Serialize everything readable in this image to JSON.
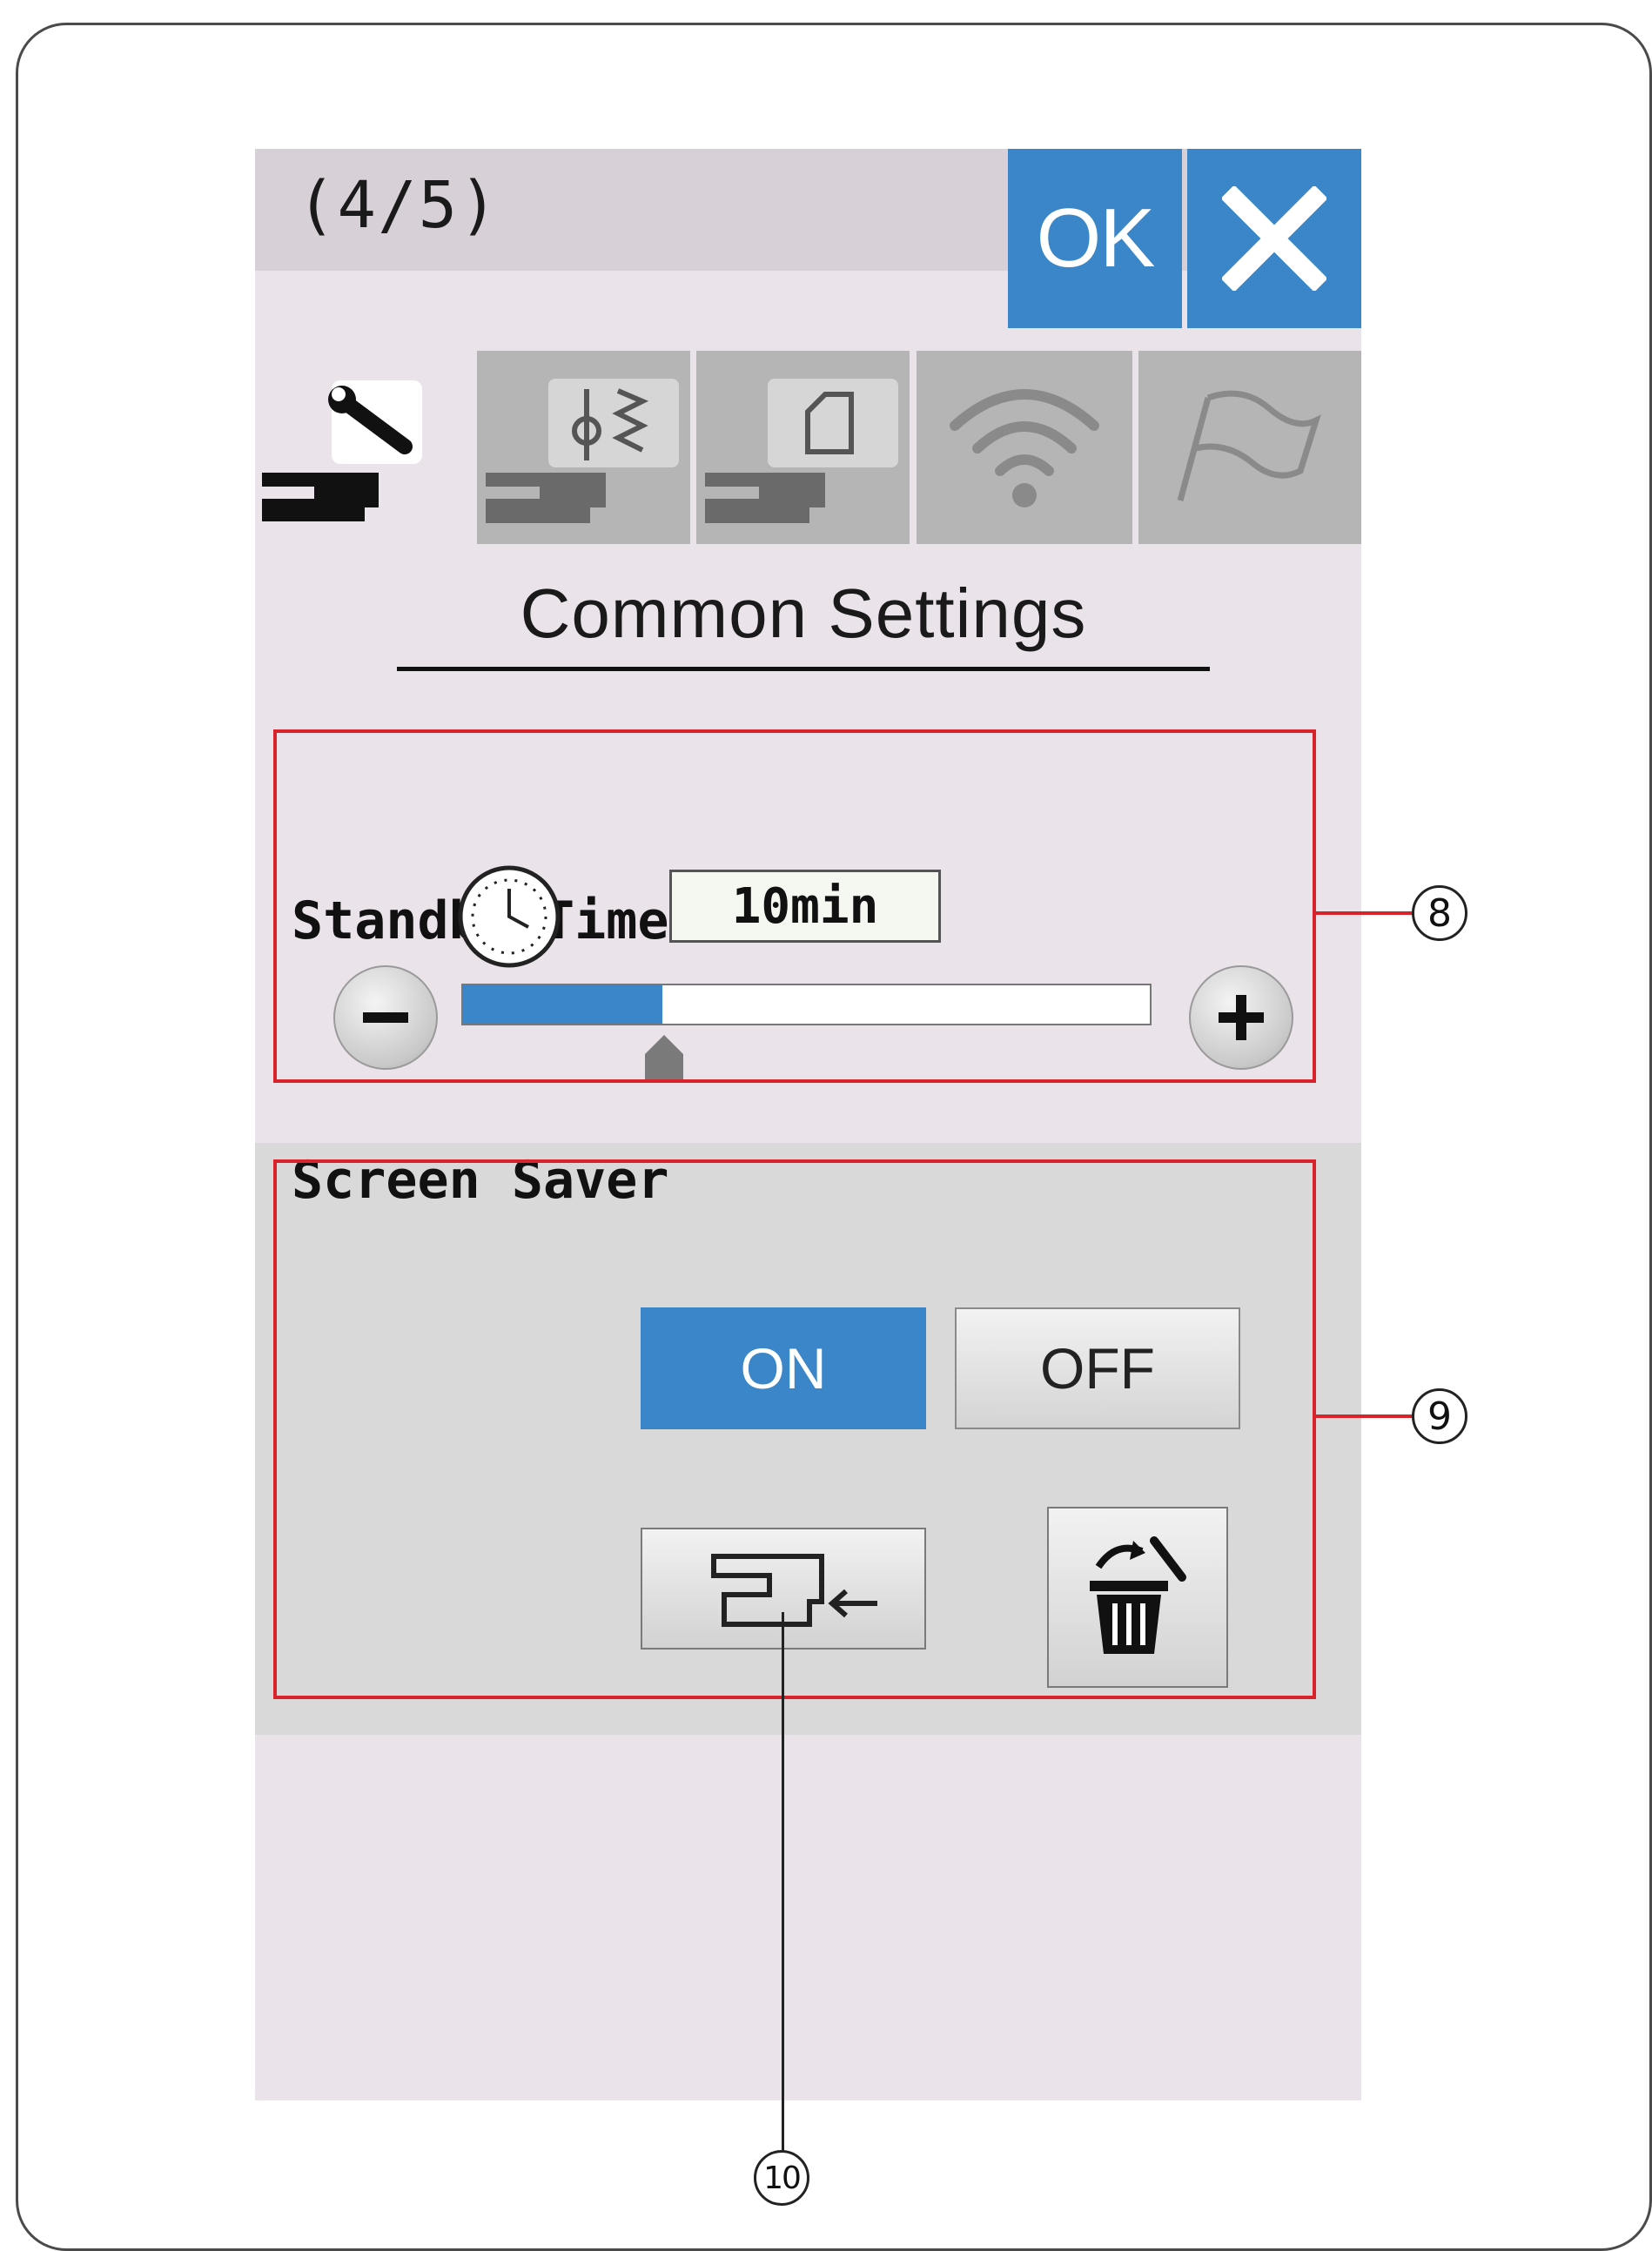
{
  "screen": {
    "page_indicator": "(4/5)",
    "ok_label": "OK",
    "close_icon": "close-x-icon",
    "tabs": [
      {
        "name": "machine-settings",
        "icon": "wrench-machine-icon",
        "active": true
      },
      {
        "name": "sewing-settings",
        "icon": "stitch-machine-icon",
        "active": false
      },
      {
        "name": "embroidery-settings",
        "icon": "hoop-machine-icon",
        "active": false
      },
      {
        "name": "wireless-settings",
        "icon": "wifi-icon",
        "active": false
      },
      {
        "name": "language-settings",
        "icon": "flag-icon",
        "active": false
      }
    ],
    "title": "Common Settings",
    "standby_timer": {
      "label": "Standby Timer",
      "value": "10min",
      "slider_fraction": 0.29,
      "minus_icon": "minus-icon",
      "plus_icon": "plus-icon",
      "clock_icon": "clock-icon"
    },
    "screen_saver": {
      "label": "Screen Saver",
      "on_label": "ON",
      "off_label": "OFF",
      "selected": "ON",
      "import_icon": "import-to-machine-icon",
      "delete_icon": "trash-icon"
    }
  },
  "callouts": {
    "standby": "8",
    "screen_saver": "9",
    "import": "10"
  },
  "colors": {
    "accent_blue": "#3a86c8",
    "callout_red": "#d8232a",
    "screen_bg": "#ebe3ea"
  }
}
